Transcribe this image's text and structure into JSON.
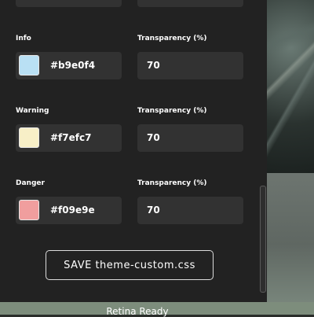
{
  "footer": {
    "caption": "Retina Ready"
  },
  "colors": [
    {
      "label": "Info",
      "hex": "#b9e0f4",
      "transparency_label": "Transparency (%)",
      "transparency": "70"
    },
    {
      "label": "Warning",
      "hex": "#f7efc7",
      "transparency_label": "Transparency (%)",
      "transparency": "70"
    },
    {
      "label": "Danger",
      "hex": "#f09e9e",
      "transparency_label": "Transparency (%)",
      "transparency": "70"
    }
  ],
  "save_button": {
    "label": "SAVE theme-custom.css"
  },
  "partial_top_swatch_color": "#cfe8c4"
}
